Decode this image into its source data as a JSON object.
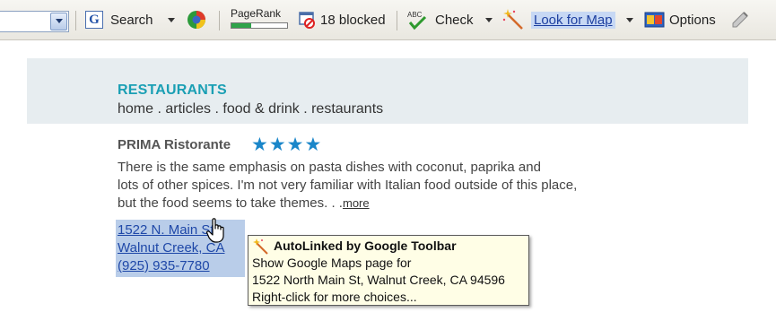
{
  "toolbar": {
    "search_label": "Search",
    "pagerank_label": "PageRank",
    "blocked_label": "18 blocked",
    "check_label": "Check",
    "lookup_label": "Look for Map",
    "options_label": "Options"
  },
  "page": {
    "section_title": "RESTAURANTS",
    "breadcrumb": "home . articles . food & drink . restaurants"
  },
  "listing": {
    "name": "PRIMA Ristorante",
    "rating": "★★★★",
    "description_1": "There is the same emphasis on pasta dishes with coconut, paprika and",
    "description_2": "lots of other spices. I'm not very familiar with Italian food outside of this place,",
    "description_3": "but the food seems to take themes. . .",
    "more_link": "more",
    "address_line1": "1522 N. Main St",
    "address_line2": "Walnut Creek, CA",
    "phone": "(925) 935-7780"
  },
  "tooltip": {
    "title": "AutoLinked by Google Toolbar",
    "line1": "Show Google Maps page for",
    "line2": "1522 North Main St, Walnut Creek, CA 94596",
    "line3": "Right-click for more choices..."
  },
  "colors": {
    "accent": "#1a9fb4",
    "stars": "#1a86c9",
    "link_highlight": "#b9cde9",
    "tooltip_bg": "#fffee6"
  }
}
